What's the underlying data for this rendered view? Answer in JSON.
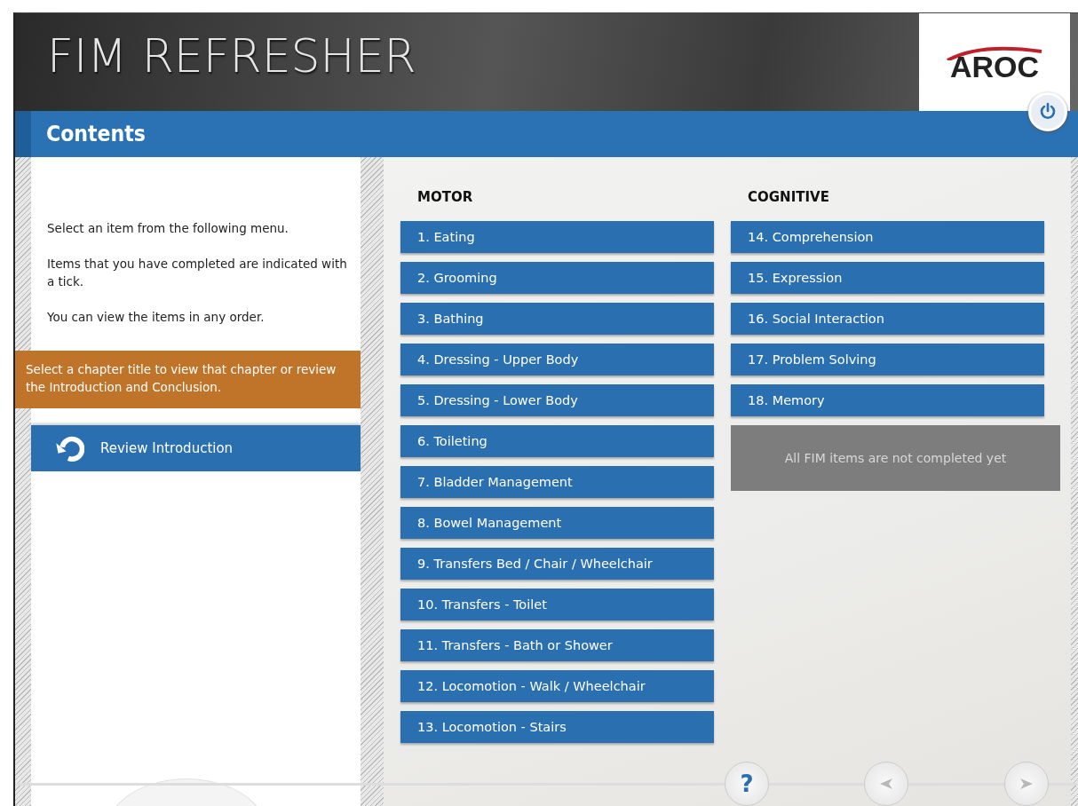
{
  "header": {
    "title": "FIM REFRESHER",
    "logo": "AROC"
  },
  "section_title": "Contents",
  "intro": [
    "Select an item from the following menu.",
    "Items that you have completed are indicated with a tick.",
    "You can view the items in any order."
  ],
  "note": "Select a chapter title to view that chapter or review the Introduction and Conclusion.",
  "review_button": "Review Introduction",
  "columns": [
    {
      "heading": "MOTOR",
      "items": [
        "1. Eating",
        "2. Grooming",
        "3. Bathing",
        "4. Dressing - Upper Body",
        "5. Dressing - Lower Body",
        "6. Toileting",
        "7. Bladder Management",
        "8. Bowel Management",
        "9. Transfers Bed / Chair / Wheelchair",
        "10. Transfers - Toilet",
        "11. Transfers - Bath or Shower",
        "12. Locomotion - Walk / Wheelchair",
        "13. Locomotion - Stairs"
      ]
    },
    {
      "heading": "COGNITIVE",
      "items": [
        "14. Comprehension",
        "15. Expression",
        "16. Social Interaction",
        "17. Problem Solving",
        "18. Memory"
      ],
      "status": "All FIM items are not completed yet"
    }
  ],
  "footer": {
    "help": "?"
  }
}
